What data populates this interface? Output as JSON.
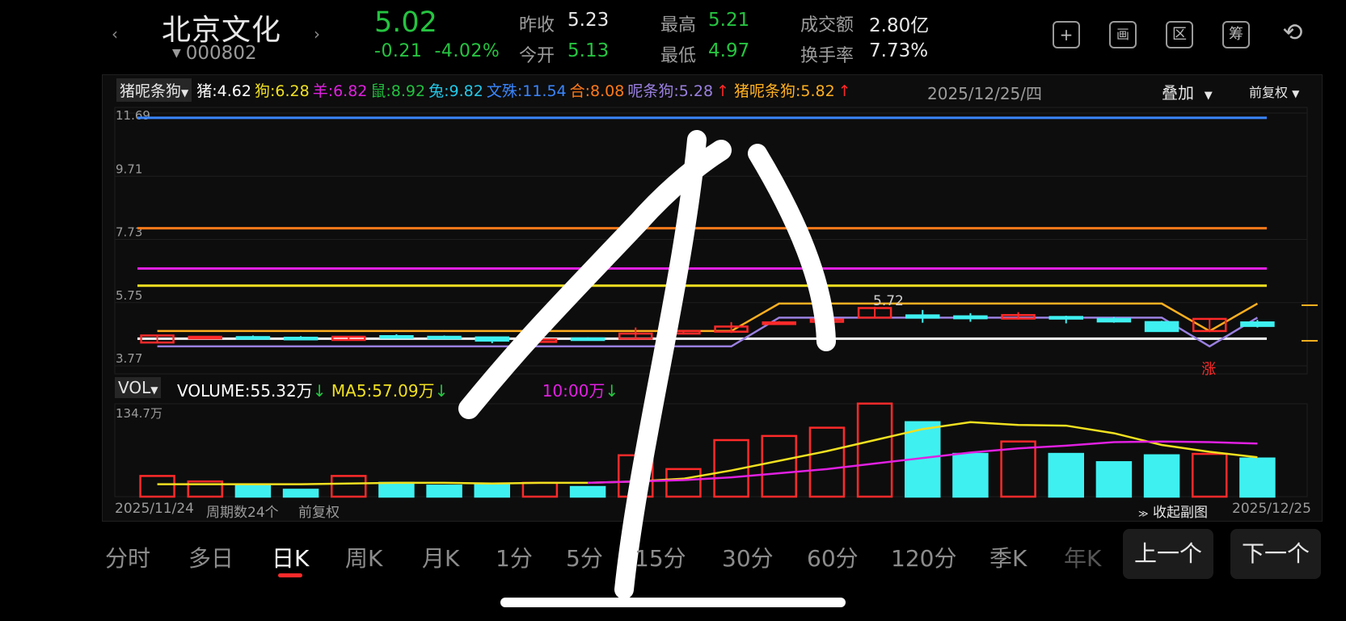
{
  "header": {
    "prev_arrow": "‹",
    "next_arrow": "›",
    "stock_name": "北京文化",
    "stock_code": "000802",
    "price": "5.02",
    "change": "-0.21",
    "change_pct": "-4.02%",
    "stats": {
      "prev_close_label": "昨收",
      "prev_close": "5.23",
      "open_label": "今开",
      "open": "5.13",
      "high_label": "最高",
      "high": "5.21",
      "low_label": "最低",
      "low": "4.97",
      "amount_label": "成交额",
      "amount": "2.80亿",
      "turnover_label": "换手率",
      "turnover": "7.73%"
    },
    "tools": [
      {
        "name": "add-icon",
        "glyph": "+"
      },
      {
        "name": "chart-icon",
        "glyph": "画"
      },
      {
        "name": "zone-icon",
        "glyph": "区"
      },
      {
        "name": "chip-icon",
        "glyph": "筹"
      },
      {
        "name": "rotate-icon",
        "glyph": "⟲"
      }
    ]
  },
  "ma_legend": {
    "dropdown": "猪呢条狗",
    "items": [
      {
        "label": "猪:",
        "value": "4.62",
        "color": "#ffffff"
      },
      {
        "label": "狗:",
        "value": "6.28",
        "color": "#f0e020"
      },
      {
        "label": "羊:",
        "value": "6.82",
        "color": "#e020e0"
      },
      {
        "label": "鼠:",
        "value": "8.92",
        "color": "#22c040"
      },
      {
        "label": "兔:",
        "value": "9.82",
        "color": "#22c8e8"
      },
      {
        "label": "文殊:",
        "value": "11.54",
        "color": "#3a86ff"
      },
      {
        "label": "合:",
        "value": "8.08",
        "color": "#ff7a1a"
      },
      {
        "label": "呢条狗:",
        "value": "5.28",
        "color": "#9a80e0",
        "arrow": "↑"
      },
      {
        "label": "猪呢条狗:",
        "value": "5.82",
        "color": "#ffb020",
        "arrow": "↑"
      }
    ],
    "date": "2025/12/25/四",
    "overlay": "叠加",
    "adjust": "前复权"
  },
  "price_axis": [
    "11.69",
    "9.71",
    "7.73",
    "5.75",
    "3.77"
  ],
  "price_annotation": "5.72",
  "limit_up_badge": "涨",
  "volume": {
    "dropdown": "VOL",
    "axis_max": "134.7万",
    "volume_label": "VOLUME:",
    "volume_value": "55.32万",
    "volume_arrow": "↓",
    "ma5_label": "MA5:",
    "ma5_value": "57.09万",
    "ma5_arrow": "↓",
    "ma10_label": "10:",
    "ma10_value": "00万",
    "ma10_arrow": "↓"
  },
  "footer": {
    "start_date": "2025/11/24",
    "period_count": "周期数24个",
    "adjust": "前复权",
    "collapse": "收起副图",
    "end_date": "2025/12/25"
  },
  "tabs": [
    "分时",
    "多日",
    "日K",
    "周K",
    "月K",
    "1分",
    "5分",
    "15分",
    "30分",
    "60分",
    "120分",
    "季K",
    "年K"
  ],
  "active_tab": "日K",
  "prev_button": "上一个",
  "next_button": "下一个",
  "chart_data": {
    "type": "candlestick",
    "dates_shown": [
      "2025/11/24",
      "2025/12/25"
    ],
    "period_count": 24,
    "y_range": [
      3.77,
      11.69
    ],
    "y_ticks": [
      11.69,
      9.71,
      7.73,
      5.75,
      3.77
    ],
    "horizontal_lines": [
      {
        "name": "文殊",
        "value": 11.54,
        "color": "#3a86ff"
      },
      {
        "name": "合",
        "value": 8.08,
        "color": "#ff7a1a"
      },
      {
        "name": "羊",
        "value": 6.82,
        "color": "#e020e0"
      },
      {
        "name": "狗",
        "value": 6.28,
        "color": "#f0e020"
      },
      {
        "name": "猪",
        "value": 4.62,
        "color": "#ffffff"
      }
    ],
    "candles": [
      {
        "o": 4.5,
        "c": 4.72,
        "h": 4.74,
        "l": 4.48,
        "up": true
      },
      {
        "o": 4.65,
        "c": 4.68,
        "h": 4.7,
        "l": 4.62,
        "up": true
      },
      {
        "o": 4.67,
        "c": 4.65,
        "h": 4.72,
        "l": 4.62,
        "up": false
      },
      {
        "o": 4.63,
        "c": 4.65,
        "h": 4.7,
        "l": 4.6,
        "up": false
      },
      {
        "o": 4.58,
        "c": 4.68,
        "h": 4.7,
        "l": 4.56,
        "up": true
      },
      {
        "o": 4.68,
        "c": 4.7,
        "h": 4.76,
        "l": 4.64,
        "up": false
      },
      {
        "o": 4.68,
        "c": 4.65,
        "h": 4.72,
        "l": 4.62,
        "up": false
      },
      {
        "o": 4.66,
        "c": 4.56,
        "h": 4.68,
        "l": 4.48,
        "up": false
      },
      {
        "o": 4.52,
        "c": 4.6,
        "h": 4.64,
        "l": 4.5,
        "up": true
      },
      {
        "o": 4.6,
        "c": 4.63,
        "h": 4.66,
        "l": 4.58,
        "up": false
      },
      {
        "o": 4.62,
        "c": 4.78,
        "h": 4.97,
        "l": 4.6,
        "up": true
      },
      {
        "o": 4.78,
        "c": 4.86,
        "h": 4.88,
        "l": 4.76,
        "up": true
      },
      {
        "o": 4.84,
        "c": 5.0,
        "h": 5.14,
        "l": 4.8,
        "up": true
      },
      {
        "o": 5.08,
        "c": 5.13,
        "h": 5.17,
        "l": 5.06,
        "up": true
      },
      {
        "o": 5.15,
        "c": 5.22,
        "h": 5.26,
        "l": 5.12,
        "up": true
      },
      {
        "o": 5.28,
        "c": 5.58,
        "h": 5.62,
        "l": 5.26,
        "up": true
      },
      {
        "o": 5.35,
        "c": 5.28,
        "h": 5.52,
        "l": 5.12,
        "up": false
      },
      {
        "o": 5.32,
        "c": 5.26,
        "h": 5.42,
        "l": 5.15,
        "up": false
      },
      {
        "o": 5.25,
        "c": 5.36,
        "h": 5.45,
        "l": 5.22,
        "up": true
      },
      {
        "o": 5.3,
        "c": 5.26,
        "h": 5.34,
        "l": 5.1,
        "up": false
      },
      {
        "o": 5.24,
        "c": 5.16,
        "h": 5.3,
        "l": 5.12,
        "up": false
      },
      {
        "o": 5.14,
        "c": 4.86,
        "h": 5.18,
        "l": 4.84,
        "up": false
      },
      {
        "o": 4.86,
        "c": 5.24,
        "h": 5.24,
        "l": 4.86,
        "up": true
      },
      {
        "o": 5.13,
        "c": 5.02,
        "h": 5.21,
        "l": 4.97,
        "up": false
      }
    ],
    "series": [
      {
        "name": "猪呢条狗",
        "color": "#ffb020",
        "values": [
          4.86,
          4.86,
          4.86,
          4.86,
          4.86,
          4.86,
          4.86,
          4.86,
          4.86,
          4.86,
          4.86,
          4.86,
          4.86,
          5.72,
          5.72,
          5.72,
          5.72,
          5.72,
          5.72,
          5.72,
          5.72,
          5.72,
          4.86,
          5.72
        ]
      },
      {
        "name": "呢条狗",
        "color": "#9a80e0",
        "values": [
          4.38,
          4.38,
          4.38,
          4.38,
          4.38,
          4.38,
          4.38,
          4.38,
          4.38,
          4.38,
          4.38,
          4.38,
          4.38,
          5.28,
          5.28,
          5.28,
          5.28,
          5.28,
          5.28,
          5.28,
          5.28,
          5.28,
          4.38,
          5.28
        ]
      }
    ],
    "volume": {
      "max": 134.7,
      "values": [
        30,
        22,
        16,
        10,
        30,
        20,
        16,
        18,
        20,
        14,
        60,
        40,
        82,
        88,
        100,
        135,
        108,
        62,
        80,
        62,
        50,
        60,
        62,
        55.32
      ],
      "up": [
        true,
        true,
        false,
        false,
        true,
        false,
        false,
        false,
        true,
        false,
        true,
        true,
        true,
        true,
        true,
        true,
        false,
        false,
        true,
        false,
        false,
        false,
        true,
        false
      ],
      "ma5": [
        18,
        18,
        18,
        18,
        19,
        20,
        20,
        19,
        20,
        20,
        22,
        26,
        38,
        52,
        66,
        82,
        98,
        108,
        104,
        103,
        92,
        75,
        65,
        57.09
      ],
      "ma10": [
        null,
        null,
        null,
        null,
        null,
        null,
        null,
        null,
        null,
        20,
        22,
        24,
        28,
        34,
        40,
        48,
        56,
        64,
        70,
        74,
        79,
        80,
        79,
        77
      ]
    }
  }
}
